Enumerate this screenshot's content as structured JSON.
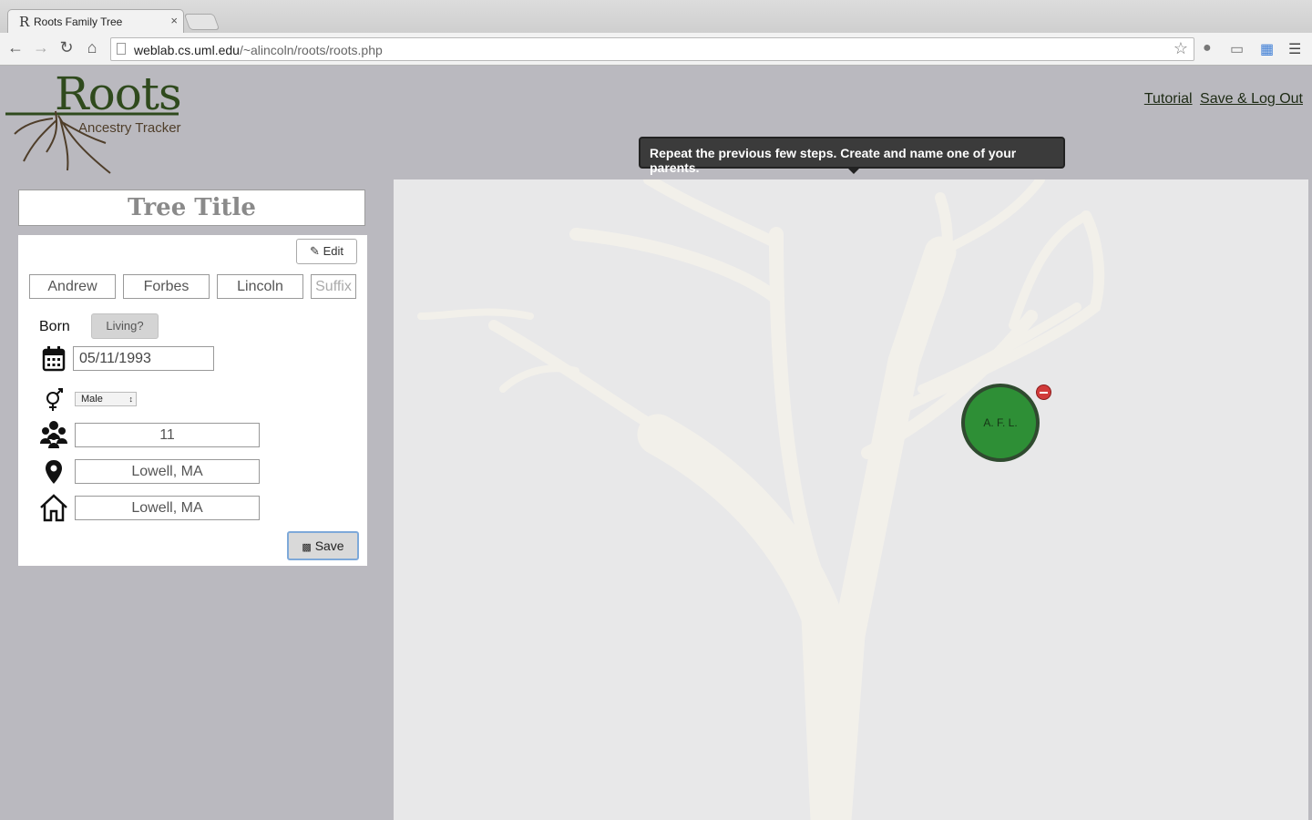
{
  "browser": {
    "tab_title": "Roots Family Tree",
    "tab_favicon": "R",
    "tab_close": "×",
    "url_host": "weblab.cs.uml.edu",
    "url_path": "/~alincoln/roots/roots.php"
  },
  "header": {
    "logo_title": "Roots",
    "logo_subtitle": "Ancestry Tracker",
    "links": {
      "tutorial": "Tutorial",
      "save_logout": "Save & Log Out"
    }
  },
  "tutorial_tooltip": "Repeat the previous few steps. Create and name one of your parents.",
  "tree_title": "Tree Title",
  "person": {
    "edit_label": "Edit",
    "first_name": "Andrew",
    "middle_name": "Forbes",
    "last_name": "Lincoln",
    "suffix_placeholder": "Suffix",
    "born_label": "Born",
    "living_label": "Living?",
    "birth_date": "05/11/1993",
    "gender": "Male",
    "siblings_count": "11",
    "birth_place": "Lowell, MA",
    "residence": "Lowell, MA",
    "save_label": "Save"
  },
  "node": {
    "initials": "A. F. L."
  },
  "colors": {
    "node_fill": "#2e8f36",
    "tooltip_bg": "#3b3b3b",
    "page_bg": "#bab9bf",
    "canvas_bg": "#e8e8e9"
  }
}
